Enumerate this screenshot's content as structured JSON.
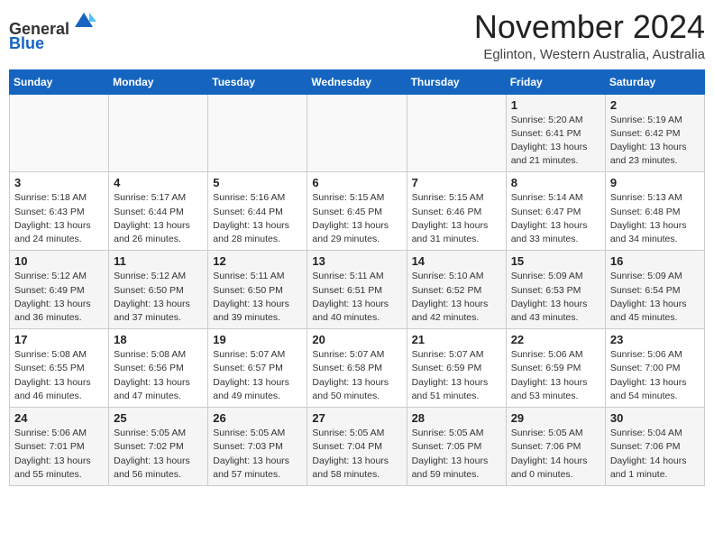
{
  "header": {
    "logo_general": "General",
    "logo_blue": "Blue",
    "month_title": "November 2024",
    "location": "Eglinton, Western Australia, Australia"
  },
  "days_of_week": [
    "Sunday",
    "Monday",
    "Tuesday",
    "Wednesday",
    "Thursday",
    "Friday",
    "Saturday"
  ],
  "weeks": [
    [
      {
        "day": "",
        "info": ""
      },
      {
        "day": "",
        "info": ""
      },
      {
        "day": "",
        "info": ""
      },
      {
        "day": "",
        "info": ""
      },
      {
        "day": "",
        "info": ""
      },
      {
        "day": "1",
        "info": "Sunrise: 5:20 AM\nSunset: 6:41 PM\nDaylight: 13 hours\nand 21 minutes."
      },
      {
        "day": "2",
        "info": "Sunrise: 5:19 AM\nSunset: 6:42 PM\nDaylight: 13 hours\nand 23 minutes."
      }
    ],
    [
      {
        "day": "3",
        "info": "Sunrise: 5:18 AM\nSunset: 6:43 PM\nDaylight: 13 hours\nand 24 minutes."
      },
      {
        "day": "4",
        "info": "Sunrise: 5:17 AM\nSunset: 6:44 PM\nDaylight: 13 hours\nand 26 minutes."
      },
      {
        "day": "5",
        "info": "Sunrise: 5:16 AM\nSunset: 6:44 PM\nDaylight: 13 hours\nand 28 minutes."
      },
      {
        "day": "6",
        "info": "Sunrise: 5:15 AM\nSunset: 6:45 PM\nDaylight: 13 hours\nand 29 minutes."
      },
      {
        "day": "7",
        "info": "Sunrise: 5:15 AM\nSunset: 6:46 PM\nDaylight: 13 hours\nand 31 minutes."
      },
      {
        "day": "8",
        "info": "Sunrise: 5:14 AM\nSunset: 6:47 PM\nDaylight: 13 hours\nand 33 minutes."
      },
      {
        "day": "9",
        "info": "Sunrise: 5:13 AM\nSunset: 6:48 PM\nDaylight: 13 hours\nand 34 minutes."
      }
    ],
    [
      {
        "day": "10",
        "info": "Sunrise: 5:12 AM\nSunset: 6:49 PM\nDaylight: 13 hours\nand 36 minutes."
      },
      {
        "day": "11",
        "info": "Sunrise: 5:12 AM\nSunset: 6:50 PM\nDaylight: 13 hours\nand 37 minutes."
      },
      {
        "day": "12",
        "info": "Sunrise: 5:11 AM\nSunset: 6:50 PM\nDaylight: 13 hours\nand 39 minutes."
      },
      {
        "day": "13",
        "info": "Sunrise: 5:11 AM\nSunset: 6:51 PM\nDaylight: 13 hours\nand 40 minutes."
      },
      {
        "day": "14",
        "info": "Sunrise: 5:10 AM\nSunset: 6:52 PM\nDaylight: 13 hours\nand 42 minutes."
      },
      {
        "day": "15",
        "info": "Sunrise: 5:09 AM\nSunset: 6:53 PM\nDaylight: 13 hours\nand 43 minutes."
      },
      {
        "day": "16",
        "info": "Sunrise: 5:09 AM\nSunset: 6:54 PM\nDaylight: 13 hours\nand 45 minutes."
      }
    ],
    [
      {
        "day": "17",
        "info": "Sunrise: 5:08 AM\nSunset: 6:55 PM\nDaylight: 13 hours\nand 46 minutes."
      },
      {
        "day": "18",
        "info": "Sunrise: 5:08 AM\nSunset: 6:56 PM\nDaylight: 13 hours\nand 47 minutes."
      },
      {
        "day": "19",
        "info": "Sunrise: 5:07 AM\nSunset: 6:57 PM\nDaylight: 13 hours\nand 49 minutes."
      },
      {
        "day": "20",
        "info": "Sunrise: 5:07 AM\nSunset: 6:58 PM\nDaylight: 13 hours\nand 50 minutes."
      },
      {
        "day": "21",
        "info": "Sunrise: 5:07 AM\nSunset: 6:59 PM\nDaylight: 13 hours\nand 51 minutes."
      },
      {
        "day": "22",
        "info": "Sunrise: 5:06 AM\nSunset: 6:59 PM\nDaylight: 13 hours\nand 53 minutes."
      },
      {
        "day": "23",
        "info": "Sunrise: 5:06 AM\nSunset: 7:00 PM\nDaylight: 13 hours\nand 54 minutes."
      }
    ],
    [
      {
        "day": "24",
        "info": "Sunrise: 5:06 AM\nSunset: 7:01 PM\nDaylight: 13 hours\nand 55 minutes."
      },
      {
        "day": "25",
        "info": "Sunrise: 5:05 AM\nSunset: 7:02 PM\nDaylight: 13 hours\nand 56 minutes."
      },
      {
        "day": "26",
        "info": "Sunrise: 5:05 AM\nSunset: 7:03 PM\nDaylight: 13 hours\nand 57 minutes."
      },
      {
        "day": "27",
        "info": "Sunrise: 5:05 AM\nSunset: 7:04 PM\nDaylight: 13 hours\nand 58 minutes."
      },
      {
        "day": "28",
        "info": "Sunrise: 5:05 AM\nSunset: 7:05 PM\nDaylight: 13 hours\nand 59 minutes."
      },
      {
        "day": "29",
        "info": "Sunrise: 5:05 AM\nSunset: 7:06 PM\nDaylight: 14 hours\nand 0 minutes."
      },
      {
        "day": "30",
        "info": "Sunrise: 5:04 AM\nSunset: 7:06 PM\nDaylight: 14 hours\nand 1 minute."
      }
    ]
  ]
}
